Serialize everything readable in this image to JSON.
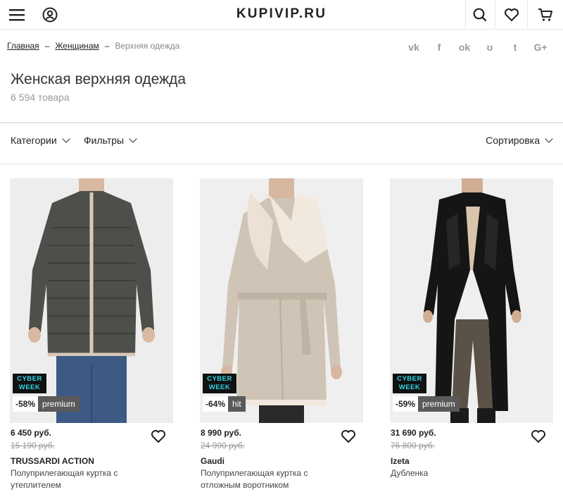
{
  "header": {
    "logo": "KUPIVIP.RU"
  },
  "breadcrumb": {
    "items": [
      "Главная",
      "Женщинам"
    ],
    "separator": "–",
    "current": "Верхняя одежда"
  },
  "share": {
    "icons": [
      "vk-icon",
      "facebook-icon",
      "odnoklassniki-icon",
      "moimir-icon",
      "twitter-icon",
      "googleplus-icon"
    ],
    "labels": [
      "vk",
      "f",
      "ok",
      "ʊ",
      "t",
      "G+"
    ]
  },
  "title": "Женская верхняя одежда",
  "count": "6 594 товара",
  "filters": {
    "categories": "Категории",
    "filters": "Фильтры",
    "sort": "Сортировка"
  },
  "products": [
    {
      "cyber": [
        "CYBER",
        "WEEK"
      ],
      "discount": "-58%",
      "tag": "premium",
      "price": "6 450 руб.",
      "old_price": "15 190 руб.",
      "brand": "TRUSSARDI ACTION",
      "description": "Полуприлегающая куртка с утеплителем"
    },
    {
      "cyber": [
        "CYBER",
        "WEEK"
      ],
      "discount": "-64%",
      "tag": "hit",
      "price": "8 990 руб.",
      "old_price": "24 990 руб.",
      "brand": "Gaudi",
      "description": "Полуприлегающая куртка с отложным воротником"
    },
    {
      "cyber": [
        "CYBER",
        "WEEK"
      ],
      "discount": "-59%",
      "tag": "premium",
      "price": "31 690 руб.",
      "old_price": "76 800 руб.",
      "brand": "Izeta",
      "description": "Дубленка"
    }
  ],
  "colors": {
    "cyber_text": "#2fd8e6",
    "tag_bg": "#5a5a5a",
    "icon_gray": "#9a9a9a"
  }
}
